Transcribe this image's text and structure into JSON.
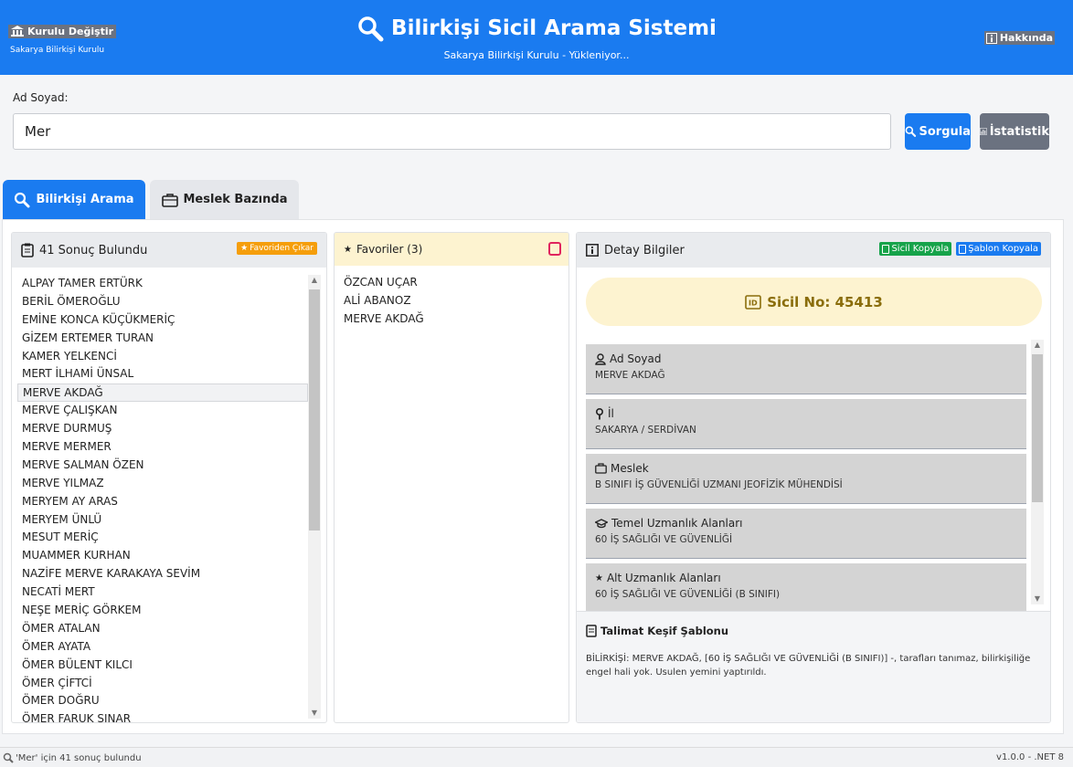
{
  "header": {
    "kurulu_btn": "Kurulu Değiştir",
    "kurulu_name": "Sakarya Bilirkişi Kurulu",
    "title": "Bilirkişi Sicil Arama Sistemi",
    "subtitle": "Sakarya Bilirkişi Kurulu - Yükleniyor...",
    "about": "Hakkında",
    "primary_color": "#1a7bf0"
  },
  "search": {
    "label": "Ad Soyad:",
    "value": "Mer",
    "query_btn": "Sorgula",
    "stats_btn": "İstatistik"
  },
  "tabs": [
    {
      "label": "Bilirkişi Arama",
      "active": true
    },
    {
      "label": "Meslek Bazında",
      "active": false
    }
  ],
  "results": {
    "title": "41 Sonuç Bulundu",
    "fav_remove_btn": "Favoriden Çıkar",
    "selected": "MERVE AKDAĞ",
    "items": [
      "ALPAY TAMER ERTÜRK",
      "BERİL ÖMEROĞLU",
      "EMİNE KONCA KÜÇÜKMERİÇ",
      "GİZEM ERTEMER TURAN",
      "KAMER YELKENCİ",
      "MERT İLHAMİ ÜNSAL",
      "MERVE AKDAĞ",
      "MERVE ÇALIŞKAN",
      "MERVE DURMUŞ",
      "MERVE MERMER",
      "MERVE SALMAN ÖZEN",
      "MERVE YILMAZ",
      "MERYEM AY ARAS",
      "MERYEM ÜNLÜ",
      "MESUT MERİÇ",
      "MUAMMER KURHAN",
      "NAZİFE MERVE KARAKAYA SEVİM",
      "NECATİ MERT",
      "NEŞE MERİÇ GÖRKEM",
      "ÖMER ATALAN",
      "ÖMER AYATA",
      "ÖMER BÜLENT KILCI",
      "ÖMER ÇİFTCİ",
      "ÖMER DOĞRU",
      "ÖMER FARUK SINAR"
    ]
  },
  "favorites": {
    "title": "Favoriler (3)",
    "items": [
      "ÖZCAN UÇAR",
      "ALİ ABANOZ",
      "MERVE AKDAĞ"
    ]
  },
  "detail": {
    "title": "Detay Bilgiler",
    "copy_sicil_btn": "Sicil Kopyala",
    "copy_template_btn": "Şablon Kopyala",
    "sicil": "Sicil No: 45413",
    "fields": [
      {
        "icon": "user-icon",
        "label": "Ad Soyad",
        "value": "MERVE AKDAĞ"
      },
      {
        "icon": "location-pin-icon",
        "label": "İl",
        "value": "SAKARYA / SERDİVAN"
      },
      {
        "icon": "briefcase-icon",
        "label": "Meslek",
        "value": "B SINIFI İŞ GÜVENLİĞİ UZMANI JEOFİZİK MÜHENDİSİ"
      },
      {
        "icon": "graduation-cap-icon",
        "label": "Temel Uzmanlık Alanları",
        "value": "60 İŞ SAĞLIĞI VE GÜVENLİĞİ"
      },
      {
        "icon": "star-icon",
        "label": "Alt Uzmanlık Alanları",
        "value": "60 İŞ SAĞLIĞI VE GÜVENLİĞİ (B SINIFI)"
      }
    ],
    "template_title": "Talimat Keşif Şablonu",
    "template_text": "BİLİRKİŞİ: MERVE AKDAĞ, [60 İŞ SAĞLIĞI VE GÜVENLİĞİ (B SINIFI)] -, tarafları tanımaz, bilirkişiliğe engel hali yok. Usulen yemini yaptırıldı."
  },
  "status": {
    "message": "'Mer' için 41 sonuç bulundu",
    "version": "v1.0.0 - .NET 8"
  }
}
